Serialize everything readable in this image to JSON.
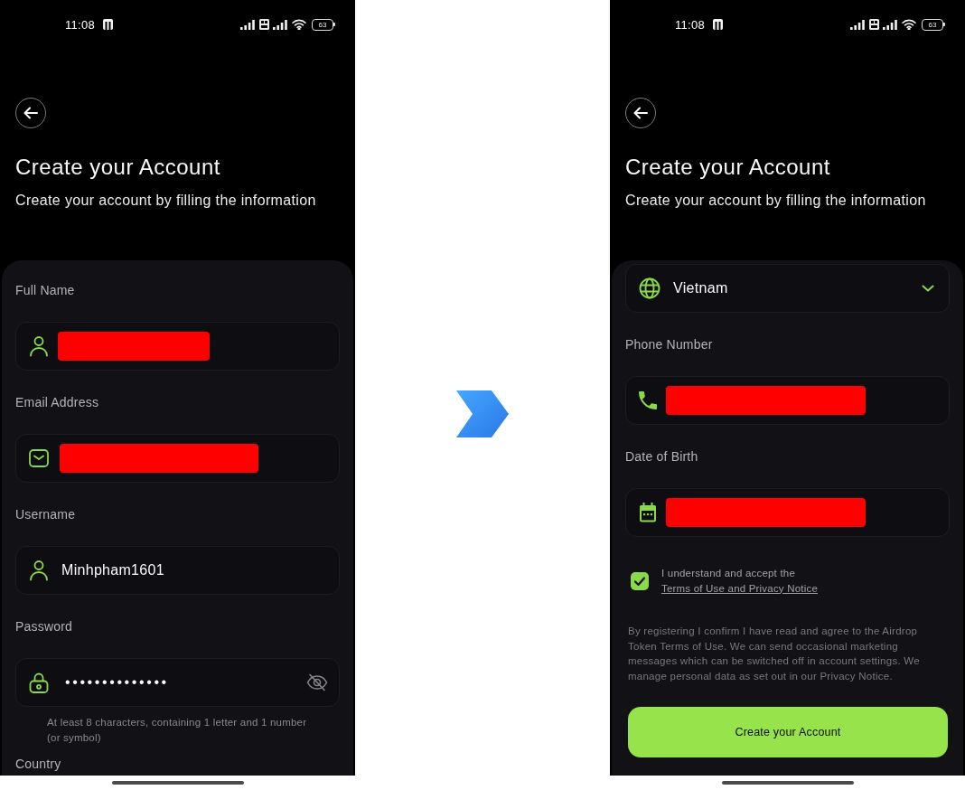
{
  "screens": [
    {
      "status_bar": {
        "time": "11:08",
        "battery": "63"
      },
      "title": "Create your Account",
      "subtitle": "Create your account by filling the information",
      "form": [
        {
          "kind": "name_field",
          "label": "Full Name",
          "redacted": true
        },
        {
          "kind": "email_field",
          "label": "Email Address",
          "redacted": true
        },
        {
          "kind": "username_field",
          "label": "Username",
          "redacted": false,
          "value": "Minhpham1601"
        },
        {
          "kind": "password_field",
          "label": "Password",
          "redacted": false,
          "value": "••••••••••••••",
          "password_hidden": true,
          "hint": "At least 8 characters, containing 1 letter and 1 number (or symbol)"
        },
        {
          "kind": "section_label",
          "label": "Country"
        }
      ]
    },
    {
      "status_bar": {
        "time": "11:08",
        "battery": "63"
      },
      "title": "Create your Account",
      "subtitle": "Create your account by filling the information",
      "form": [
        {
          "kind": "country_select",
          "value": "Vietnam"
        },
        {
          "kind": "phone_field",
          "label": "Phone Number",
          "redacted": true
        },
        {
          "kind": "date_field",
          "label": "Date of Birth",
          "redacted": true
        },
        {
          "kind": "consent",
          "checked": true,
          "text": "I understand and accept the",
          "link": "Terms of Use and Privacy Notice"
        },
        {
          "kind": "notice",
          "text": "By registering I confirm I have read and agree to the Airdrop Token Terms of Use. We can send occasional marketing messages which can be switched off in account settings. We manage personal data as set out in our Privacy Notice."
        },
        {
          "kind": "button",
          "label": "Create your Account"
        }
      ]
    }
  ]
}
